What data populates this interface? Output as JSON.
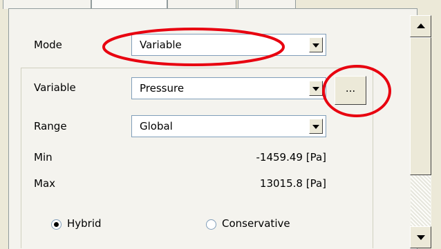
{
  "mode": {
    "label": "Mode",
    "value": "Variable"
  },
  "variable": {
    "label": "Variable",
    "value": "Pressure",
    "browse_label": "..."
  },
  "range": {
    "label": "Range",
    "value": "Global"
  },
  "min": {
    "label": "Min",
    "value": "-1459.49 [Pa]"
  },
  "max": {
    "label": "Max",
    "value": "13015.8 [Pa]"
  },
  "radio": {
    "options": [
      {
        "label": "Hybrid",
        "checked": true
      },
      {
        "label": "Conservative",
        "checked": false
      }
    ]
  },
  "annotations": {
    "color": "#e8000f"
  }
}
